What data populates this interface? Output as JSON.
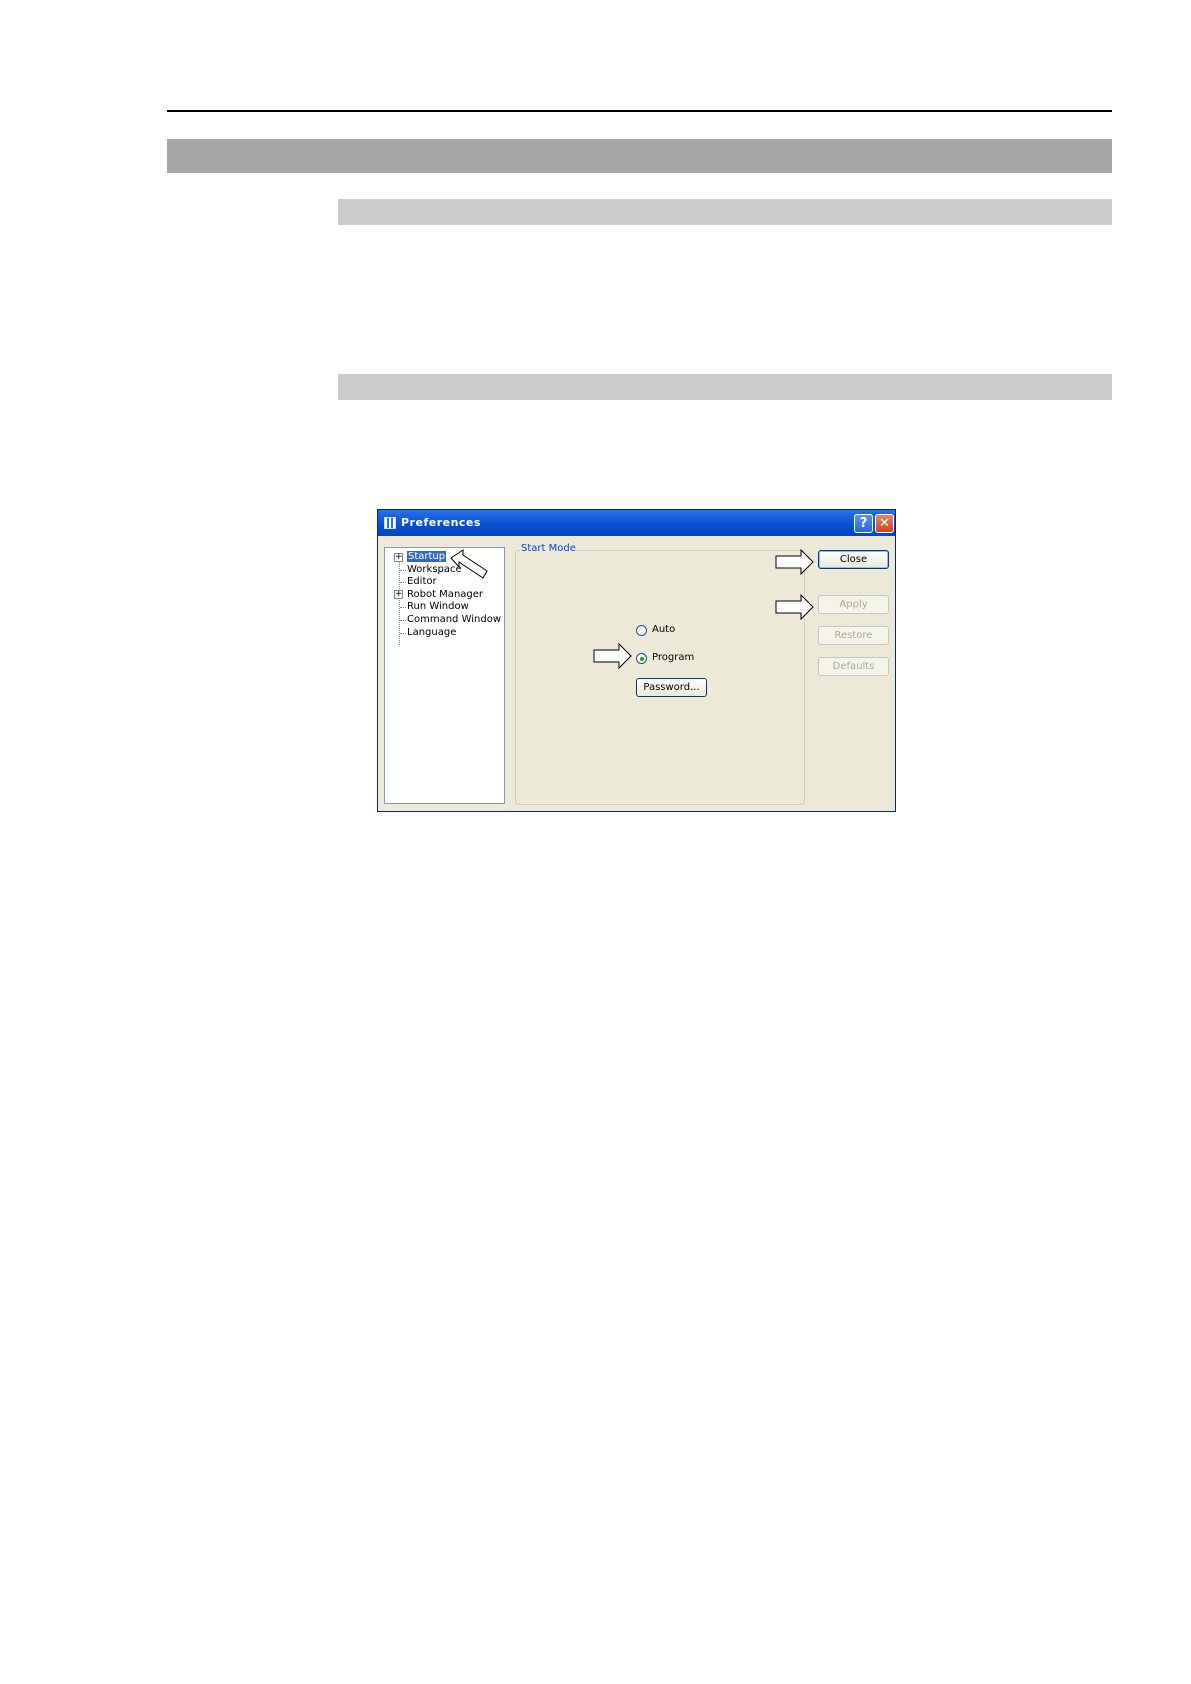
{
  "dialog": {
    "title": "Preferences",
    "help_button": "?",
    "close_glyph": "✕",
    "tree": [
      {
        "label": "Startup",
        "expandable": true,
        "selected": true
      },
      {
        "label": "Workspace",
        "expandable": false
      },
      {
        "label": "Editor",
        "expandable": false
      },
      {
        "label": "Robot Manager",
        "expandable": true
      },
      {
        "label": "Run Window",
        "expandable": false
      },
      {
        "label": "Command Window",
        "expandable": false
      },
      {
        "label": "Language",
        "expandable": false
      }
    ],
    "group_label": "Start Mode",
    "radios": [
      {
        "label": "Auto",
        "checked": false
      },
      {
        "label": "Program",
        "checked": true
      }
    ],
    "password_button": "Password...",
    "buttons": {
      "close": "Close",
      "apply": "Apply",
      "restore": "Restore",
      "defaults": "Defaults"
    }
  },
  "colors": {
    "titlebar": "#0a4fd0",
    "dialog_bg": "#ece9d8",
    "section_dark": "#a6a6a6",
    "section_light": "#cccccc"
  }
}
